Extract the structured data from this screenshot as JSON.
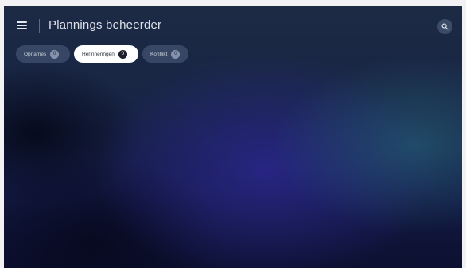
{
  "header": {
    "title": "Plannings beheerder",
    "menu_icon": "hamburger-menu-icon",
    "search_icon": "search-icon"
  },
  "tabs": [
    {
      "label": "Opnames",
      "count": "0",
      "active": false
    },
    {
      "label": "Herinneringen",
      "count": "0",
      "active": true
    },
    {
      "label": "Konflikt",
      "count": "0",
      "active": false
    }
  ],
  "colors": {
    "background_top": "#1d2a44",
    "background_bottom": "#0c1030",
    "active_tab": "#ffffff",
    "inactive_tab": "#4a5a78"
  }
}
